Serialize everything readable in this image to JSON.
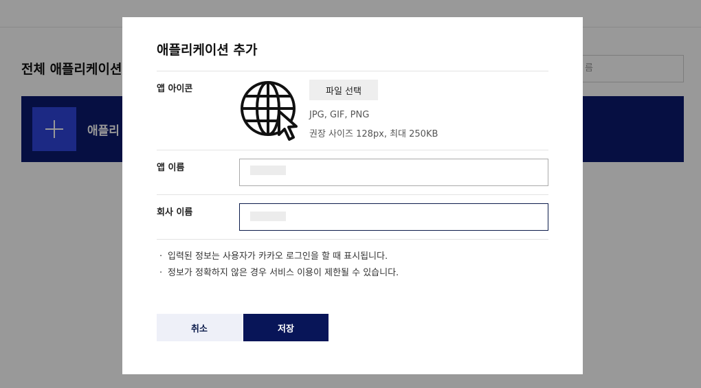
{
  "background": {
    "title": "전체 애플리케이션",
    "search_placeholder": "름",
    "add_tile_label": "애플리",
    "banner_color": "#0a1a6e",
    "add_tile_color": "#2f45dc"
  },
  "modal": {
    "title": "애플리케이션 추가",
    "icon_row": {
      "label": "앱 아이콘",
      "icon_name": "globe-cursor-icon",
      "file_button": "파일 선택",
      "hint_formats": "JPG, GIF, PNG",
      "hint_size": "권장 사이즈 128px, 최대 250KB"
    },
    "app_name_row": {
      "label": "앱 이름",
      "value": ""
    },
    "company_name_row": {
      "label": "회사 이름",
      "value": ""
    },
    "notes": [
      "입력된 정보는 사용자가 카카오 로그인을 할 때 표시됩니다.",
      "정보가 정확하지 않은 경우 서비스 이용이 제한될 수 있습니다."
    ],
    "cancel_label": "취소",
    "save_label": "저장",
    "save_color": "#081558"
  }
}
